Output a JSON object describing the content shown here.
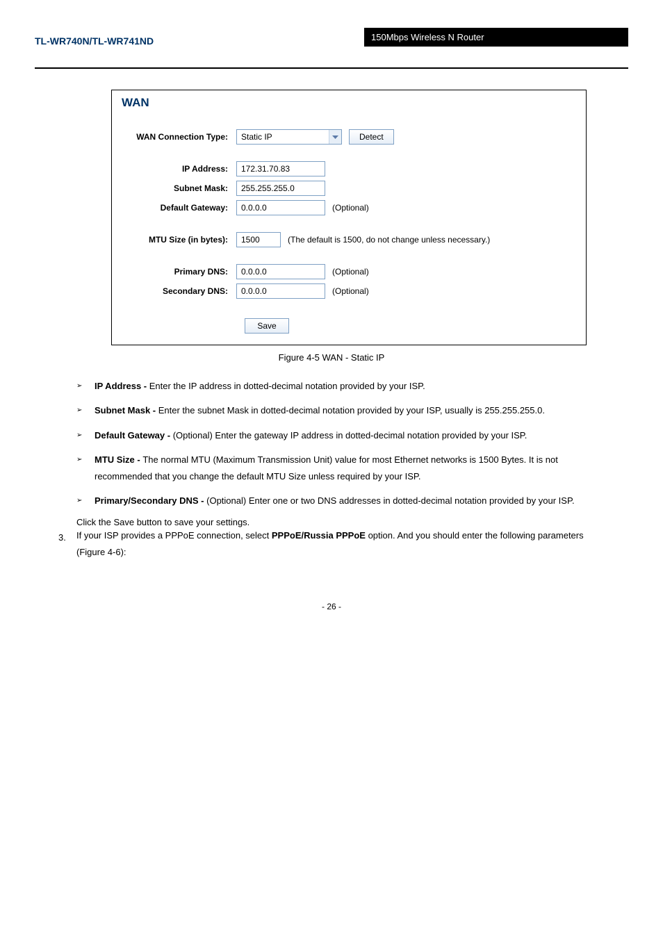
{
  "header": {
    "left": "TL-WR740N/TL-WR741ND",
    "right": "150Mbps Wireless N Router"
  },
  "figure": {
    "panel_title": "WAN",
    "conn_type_label": "WAN Connection Type:",
    "conn_type_value": "Static IP",
    "detect_btn": "Detect",
    "ip_label": "IP Address:",
    "ip_value": "172.31.70.83",
    "mask_label": "Subnet Mask:",
    "mask_value": "255.255.255.0",
    "gw_label": "Default Gateway:",
    "gw_value": "0.0.0.0",
    "gw_opt": "(Optional)",
    "mtu_label": "MTU Size (in bytes):",
    "mtu_value": "1500",
    "mtu_note": "(The default is 1500, do not change unless necessary.)",
    "dns1_label": "Primary DNS:",
    "dns1_value": "0.0.0.0",
    "dns1_opt": "(Optional)",
    "dns2_label": "Secondary DNS:",
    "dns2_value": "0.0.0.0",
    "dns2_opt": "(Optional)",
    "save_btn": "Save",
    "caption": "Figure 4-5 WAN - Static IP"
  },
  "bullets": [
    {
      "term": "IP Address - ",
      "text": "Enter the IP address in dotted-decimal notation provided by your ISP."
    },
    {
      "term": "Subnet Mask - ",
      "text": "Enter the subnet Mask in dotted-decimal notation provided by your ISP, usually is 255.255.255.0."
    },
    {
      "term": "Default Gateway - ",
      "text": "(Optional) Enter the gateway IP address in dotted-decimal notation provided by your ISP."
    },
    {
      "term": "MTU Size - ",
      "text": "The normal MTU (Maximum Transmission Unit) value for most Ethernet networks is 1500 Bytes. It is not recommended that you change the default MTU Size unless required by your ISP."
    },
    {
      "term": "Primary/Secondary DNS - ",
      "text": "(Optional) Enter one or two DNS addresses in dotted-decimal notation provided by your ISP."
    }
  ],
  "post_text": "Click the Save button to save your settings.",
  "section3": {
    "num": "3. ",
    "text1": "If  your  ISP  provides  a  PPPoE  connection,  select ",
    "bold": "PPPoE/Russia PPPoE ",
    "text2": "option.  And  you should enter the following parameters (Figure 4-6):"
  },
  "page_number": "- 26 -"
}
